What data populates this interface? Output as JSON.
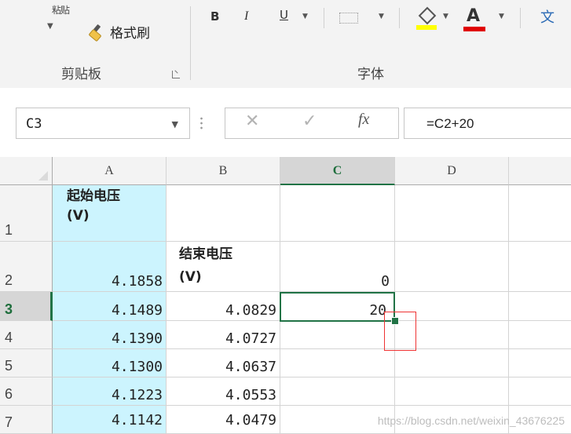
{
  "ribbon": {
    "paste_partial": "粘贴",
    "format_painter": "格式刷",
    "clipboard_group": "剪贴板",
    "font_group": "字体",
    "bold": "B",
    "italic": "I",
    "underline": "U",
    "font_color_letter": "A",
    "wen_label": "文",
    "fill_color": "#ffff00",
    "font_color": "#e00000"
  },
  "formula_bar": {
    "name_box": "C3",
    "cancel_glyph": "✕",
    "enter_glyph": "✓",
    "fx_label": "fx",
    "formula": "=C2+20"
  },
  "grid": {
    "columns": [
      "A",
      "B",
      "C",
      "D"
    ],
    "selected_column": "C",
    "rows": [
      "1",
      "2",
      "3",
      "4",
      "5",
      "6",
      "7"
    ],
    "selected_row": "3",
    "header_a1": "起始电压 (V)",
    "header_b2": "结束电压 (V)",
    "col_a_values": [
      "4.1858",
      "4.1489",
      "4.1390",
      "4.1300",
      "4.1223",
      "4.1142"
    ],
    "col_b_values": [
      "4.0829",
      "4.0727",
      "4.0637",
      "4.0553",
      "4.0479"
    ],
    "col_c_values": [
      "0",
      "20"
    ],
    "active_cell": "C3"
  },
  "watermark": "https://blog.csdn.net/weixin_43676225",
  "colors": {
    "accent": "#217346",
    "col_a_fill": "#ccf4fe",
    "annotation_box": "#e33333"
  }
}
